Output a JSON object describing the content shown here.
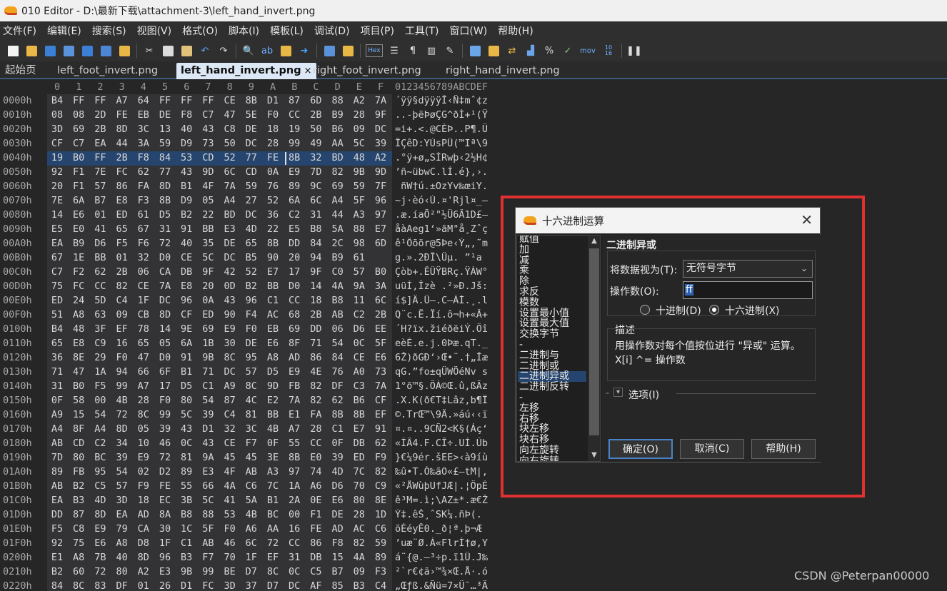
{
  "app": {
    "title": "010 Editor - D:\\最新下载\\attachment-3\\left_hand_invert.png"
  },
  "menu": [
    "文件(F)",
    "编辑(E)",
    "搜索(S)",
    "视图(V)",
    "格式(O)",
    "脚本(I)",
    "模板(L)",
    "调试(D)",
    "项目(P)",
    "工具(T)",
    "窗口(W)",
    "帮助(H)"
  ],
  "toolbar": {
    "hex_label": "Hex",
    "mov_label": "mov",
    "binary_label": "10\n16"
  },
  "tabs": {
    "start": "起始页",
    "items": [
      "left_foot_invert.png",
      "left_hand_invert.png",
      "right_foot_invert.png",
      "right_hand_invert.png"
    ],
    "active_index": 1,
    "close": "×"
  },
  "hex": {
    "columns": [
      "0",
      "1",
      "2",
      "3",
      "4",
      "5",
      "6",
      "7",
      "8",
      "9",
      "A",
      "B",
      "C",
      "D",
      "E",
      "F"
    ],
    "ascii_header": "0123456789ABCDEF",
    "selected_row": 4,
    "caret_col": 11,
    "rows": [
      {
        "addr": "0000h",
        "bytes": "B4 FF FF A7 64 FF FF FF CE 8B D1 87 6D 88 A2 7A",
        "ascii": "´ÿÿ§dÿÿÿÎ‹Ñ‡mˆ¢z"
      },
      {
        "addr": "0010h",
        "bytes": "08 08 2D FE EB DE F8 C7 47 5E F0 CC 2B B9 28 9F",
        "ascii": "..-þëÞøÇG^ðÌ+¹(Ÿ"
      },
      {
        "addr": "0020h",
        "bytes": "3D 69 2B 8D 3C 13 40 43 C8 DE 18 19 50 B6 09 DC",
        "ascii": "=i+.<.@CÈÞ..P¶.Ü"
      },
      {
        "addr": "0030h",
        "bytes": "CF C7 EA 44 3A 59 D9 73 50 DC 28 99 49 AA 5C 39",
        "ascii": "ÏÇêD:YÙsPÜ(™Iª\\9"
      },
      {
        "addr": "0040h",
        "bytes": "19 B0 FF 2B F8 84 53 CD 52 77 FE 8B 32 BD 48 A2",
        "ascii": ".°ÿ+ø„SÍRwþ‹2½H¢"
      },
      {
        "addr": "0050h",
        "bytes": "92 F1 7E FC 62 77 43 9D 6C CD 0A E9 7D 82 9B 9D",
        "ascii": "’ñ~übwC.lÍ.é},›."
      },
      {
        "addr": "0060h",
        "bytes": "20 F1 57 86 FA 8D B1 4F 7A 59 76 89 9C 69 59 7F",
        "ascii": " ñW†ú.±OzYv‰œiY."
      },
      {
        "addr": "0070h",
        "bytes": "7E 6A B7 E8 F3 8B D9 05 A4 27 52 6A 6C A4 5F 96",
        "ascii": "~j·èó‹Ù.¤'Rjl¤_–"
      },
      {
        "addr": "0080h",
        "bytes": "14 E6 01 ED 61 D5 B2 22 BD DC 36 C2 31 44 A3 97",
        "ascii": ".æ.íaÕ²\"½Ü6Â1D£—"
      },
      {
        "addr": "0090h",
        "bytes": "E5 E0 41 65 67 31 91 BB E3 4D 22 E5 B8 5A 88 E7",
        "ascii": "åàAeg1‘»ãM\"å¸Zˆç"
      },
      {
        "addr": "00A0h",
        "bytes": "EA B9 D6 F5 F6 72 40 35 DE 65 8B DD 84 2C 98 6D",
        "ascii": "ê¹Öõör@5Þe‹Ý„,˜m"
      },
      {
        "addr": "00B0h",
        "bytes": "67 1E BB 01 32 D0 CE 5C DC B5 90 20 94 B9 61",
        "ascii": "g.».2ÐÎ\\Üµ. ”¹a"
      },
      {
        "addr": "00C0h",
        "bytes": "C7 F2 62 2B 06 CA DB 9F 42 52 E7 17 9F C0 57 B0",
        "ascii": "Çòb+.ÊÛŸBRç.ŸÀW°"
      },
      {
        "addr": "00D0h",
        "bytes": "75 FC CC 82 CE 7A E8 20 0D B2 BB D0 14 4A 9A 3A",
        "ascii": "uüÌ‚Îzè .²»Ð.Jš:"
      },
      {
        "addr": "00E0h",
        "bytes": "ED 24 5D C4 1F DC 96 0A 43 96 C1 CC 18 B8 11 6C",
        "ascii": "í$]Ä.Ü–.C–ÁÌ.¸.l"
      },
      {
        "addr": "00F0h",
        "bytes": "51 A8 63 09 CB 8D CF ED 90 F4 AC 68 2B AB C2 2B",
        "ascii": "Q¨c.Ë.Ïí.ô¬h+«Â+"
      },
      {
        "addr": "0100h",
        "bytes": "B4 48 3F EF 78 14 9E 69 E9 F0 EB 69 DD 06 D6 EE",
        "ascii": "´H?ïx.žiéðëiÝ.Öî"
      },
      {
        "addr": "0110h",
        "bytes": "65 E8 C9 16 65 05 6A 1B 30 DE E6 8F 71 54 0C 5F",
        "ascii": "eèÉ.e.j.0Þæ.qT._"
      },
      {
        "addr": "0120h",
        "bytes": "36 8E 29 F0 47 D0 91 9B 8C 95 A8 AD 86 84 CE E6",
        "ascii": "6Ž)ðGÐ‘›Œ•¨.†„Îæ"
      },
      {
        "addr": "0130h",
        "bytes": "71 47 1A 94 66 6F B1 71 DC 57 D5 E9 4E 76 A0 73",
        "ascii": "qG.”fo±qÜWÕéNv s"
      },
      {
        "addr": "0140h",
        "bytes": "31 B0 F5 99 A7 17 D5 C1 A9 8C 9D FB 82 DF C3 7A",
        "ascii": "1°õ™§.ÕÁ©Œ.û‚ßÃz"
      },
      {
        "addr": "0150h",
        "bytes": "0F 58 00 4B 28 F0 80 54 87 4C E2 7A 82 62 B6 CF",
        "ascii": ".X.K(ð€T‡Lâz‚b¶Ï"
      },
      {
        "addr": "0160h",
        "bytes": "A9 15 54 72 8C 99 5C 39 C4 81 BB E1 FA 8B 8B EF",
        "ascii": "©.TrŒ™\\9Ä.»áú‹‹ï"
      },
      {
        "addr": "0170h",
        "bytes": "A4 8F A4 8D 05 39 43 D1 32 3C 4B A7 28 C1 E7 91",
        "ascii": "¤.¤..9CÑ2<K§(Áç‘"
      },
      {
        "addr": "0180h",
        "bytes": "AB CD C2 34 10 46 0C 43 CE F7 0F 55 CC 0F DB 62",
        "ascii": "«ÍÂ4.F.CÎ÷.UÌ.Ûb"
      },
      {
        "addr": "0190h",
        "bytes": "7D 80 BC 39 E9 72 81 9A 45 45 3E 8B E0 39 ED F9",
        "ascii": "}€¼9ér.šEE>‹à9íù"
      },
      {
        "addr": "01A0h",
        "bytes": "89 FB 95 54 02 D2 89 E3 4F AB A3 97 74 4D 7C 82",
        "ascii": "‰û•T.Ò‰ãO«£—tM|‚"
      },
      {
        "addr": "01B0h",
        "bytes": "AB B2 C5 57 F9 FE 55 66 4A C6 7C 1A A6 D6 70 C9",
        "ascii": "«²ÅWùþUfJÆ|.¦ÖpÉ"
      },
      {
        "addr": "01C0h",
        "bytes": "EA B3 4D 3D 18 EC 3B 5C 41 5A B1 2A 0E E6 80 8E",
        "ascii": "ê³M=.ì;\\AZ±*.æ€Ž"
      },
      {
        "addr": "01D0h",
        "bytes": "DD 87 8D EA AD 8A B8 88 53 4B BC 00 F1 DE 28 1D",
        "ascii": "Ý‡.ê­Š¸ˆSK¼.ñÞ(."
      },
      {
        "addr": "01E0h",
        "bytes": "F5 C8 E9 79 CA 30 1C 5F F0 A6 AA 16 FE AD AC C6",
        "ascii": "õÈéyÊ0._ð¦ª.þ­¬Æ"
      },
      {
        "addr": "01F0h",
        "bytes": "92 75 E6 A8 D8 1F C1 AB 46 6C 72 CC 86 F8 82 59",
        "ascii": "’uæ¨Ø.Á«FlrÌ†ø‚Y"
      },
      {
        "addr": "0200h",
        "bytes": "E1 A8 7B 40 8D 96 B3 F7 70 1F EF 31 DB 15 4A 89",
        "ascii": "á¨{@.–³÷p.ï1Û.J‰"
      },
      {
        "addr": "0210h",
        "bytes": "B2 60 72 80 A2 E3 9B 99 BE D7 8C 0C C5 B7 09 F3",
        "ascii": "²`r€¢ã›™¾×Œ.Å·.ó"
      },
      {
        "addr": "0220h",
        "bytes": "84 8C 83 DF 01 26 D1 FC 3D 37 D7 DC AF 85 B3 C4",
        "ascii": "„Œƒß.&Ñü=7×Ü¯…³Ä"
      }
    ]
  },
  "dialog": {
    "title": "十六进制运算",
    "close": "✕",
    "operations": [
      "赋值",
      "加",
      "减",
      "乘",
      "除",
      "求反",
      "模数",
      "设置最小值",
      "设置最大值",
      "交换字节",
      "-",
      "二进制与",
      "二进制或",
      "二进制异或",
      "二进制反转",
      "-",
      "左移",
      "右移",
      "块左移",
      "块右移",
      "向左旋转",
      "向右旋转"
    ],
    "selected_operation": 13,
    "heading": "二进制异或",
    "treat_label": "将数据视为(T):",
    "treat_value": "无符号字节",
    "operand_label": "操作数(O):",
    "operand_value": "ff",
    "radio_dec": "十进制(D)",
    "radio_hex": "十六进制(X)",
    "radio_selected": "hex",
    "desc_title": "描述",
    "desc_line1": "用操作数对每个值按位进行 \"异或\" 运算。",
    "desc_line2": "X[i] ^= 操作数",
    "options_label": "选项(I)",
    "ok": "确定(O)",
    "cancel": "取消(C)",
    "help": "帮助(H)"
  },
  "watermark": "CSDN @Peterpan00000"
}
